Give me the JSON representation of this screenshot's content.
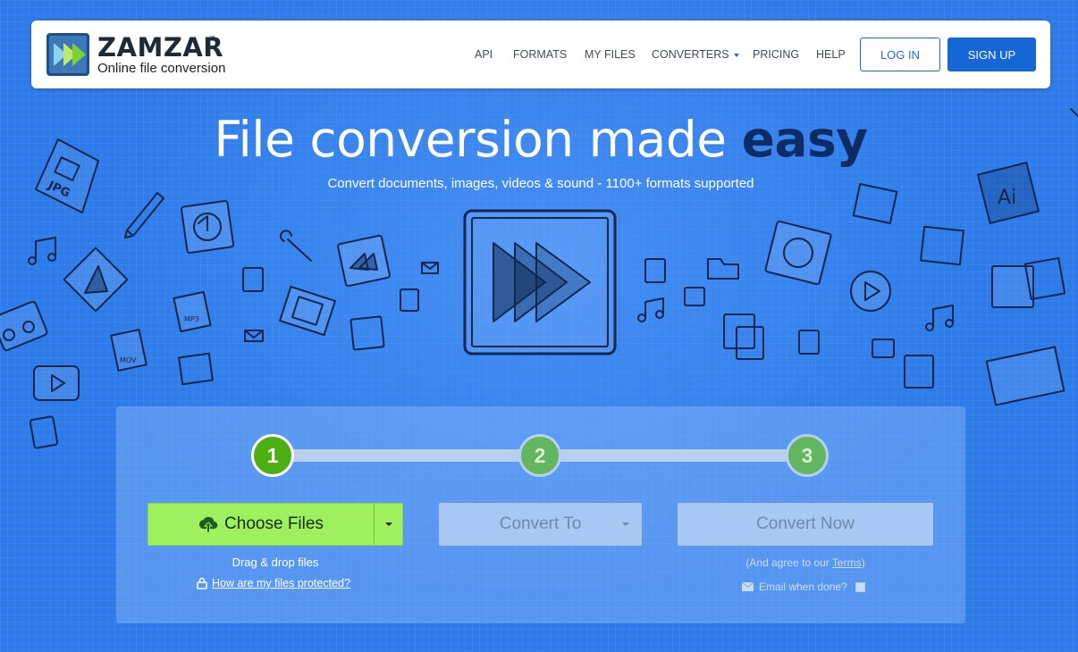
{
  "brand": {
    "name": "ZAMZAR",
    "trademark": "™",
    "tagline": "Online file conversion"
  },
  "nav": {
    "items": [
      "API",
      "FORMATS",
      "MY FILES",
      "CONVERTERS",
      "PRICING",
      "HELP"
    ],
    "login": "LOG IN",
    "signup": "SIGN UP"
  },
  "hero": {
    "title_main": "File conversion made ",
    "title_emphasis": "easy",
    "subtitle": "Convert documents, images, videos & sound - 1100+ formats supported"
  },
  "doodle_labels": {
    "jpg": "JPG",
    "mp3": "MP3",
    "mov": "MOV",
    "ai": "Ai"
  },
  "steps": [
    "1",
    "2",
    "3"
  ],
  "converter": {
    "choose_files": "Choose Files",
    "drag_drop": "Drag & drop files",
    "protected_link": "How are my files protected?",
    "convert_to": "Convert To",
    "convert_now": "Convert Now",
    "agree_prefix": "(And agree to our ",
    "terms_link": "Terms",
    "agree_suffix": ")",
    "email_label": "Email when done?"
  },
  "colors": {
    "background": "#2d7ae8",
    "brand_blue": "#1667d6",
    "choose_green": "#9ef05f",
    "step_active": "#4caf12",
    "title_emphasis": "#0d2c66"
  }
}
